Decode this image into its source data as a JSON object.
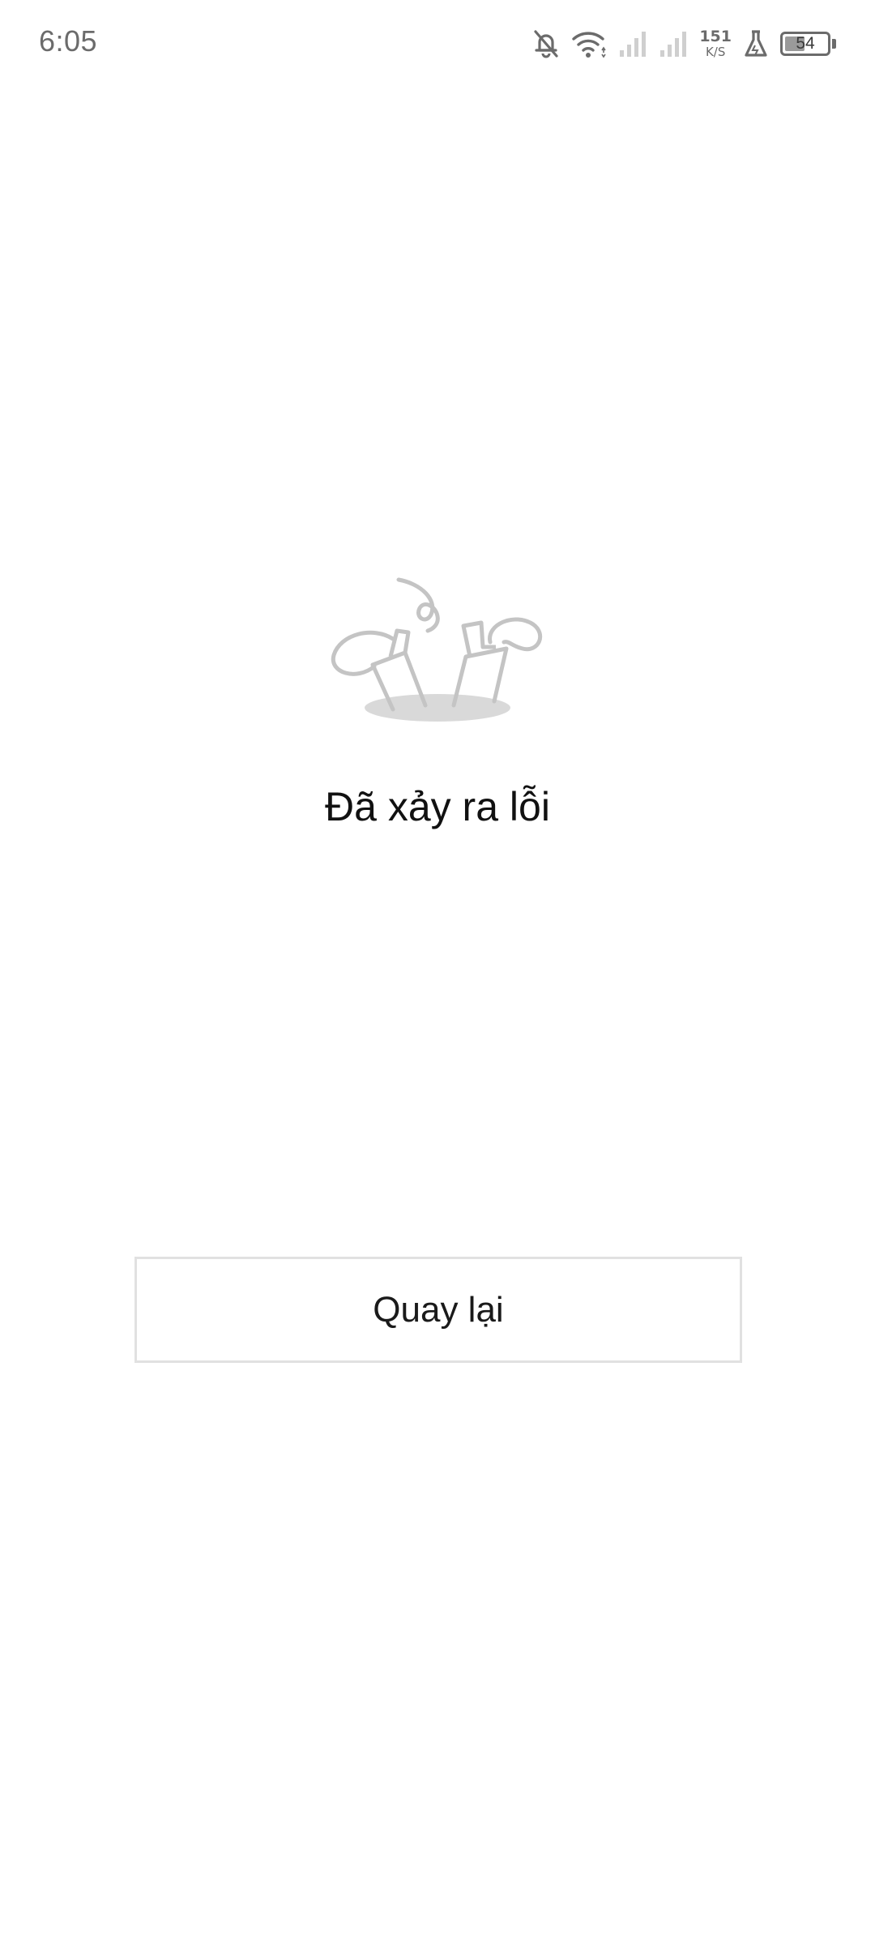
{
  "status_bar": {
    "time": "6:05",
    "net_speed_value": "151",
    "net_speed_unit": "K/S",
    "battery_level": 54,
    "battery_text": "54",
    "icons": [
      "bell-off-icon",
      "wifi-icon",
      "signal-icon",
      "signal-icon",
      "flask-icon",
      "battery-icon"
    ]
  },
  "error": {
    "illustration": "error-illustration",
    "title": "Đã xảy ra lỗi"
  },
  "actions": {
    "back_label": "Quay lại"
  },
  "colors": {
    "background": "#ffffff",
    "status_icon": "#6b6b6b",
    "illustration": "#c8c8c8",
    "title_text": "#111111",
    "button_border": "#e1e1e1"
  }
}
